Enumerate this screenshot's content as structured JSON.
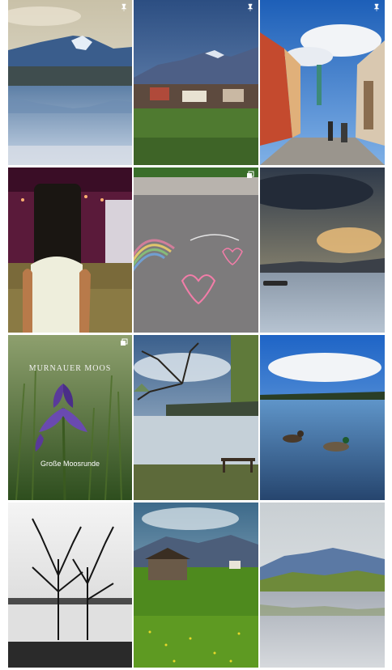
{
  "grid": {
    "posts": [
      {
        "name": "post-lake-mountain-reflection",
        "badge": "pin"
      },
      {
        "name": "post-village-mountains",
        "badge": "pin"
      },
      {
        "name": "post-old-town-street",
        "badge": "pin"
      },
      {
        "name": "post-stage-lights",
        "badge": "none"
      },
      {
        "name": "post-chalk-drawing",
        "badge": "carousel"
      },
      {
        "name": "post-sunset-lake-boat",
        "badge": "none"
      },
      {
        "name": "post-iris-flower",
        "badge": "carousel",
        "title": "MURNAUER MOOS",
        "subtitle": "Große Moosrunde"
      },
      {
        "name": "post-lake-tree-bench",
        "badge": "none"
      },
      {
        "name": "post-ducks-lake",
        "badge": "none"
      },
      {
        "name": "post-bw-trees",
        "badge": "none"
      },
      {
        "name": "post-meadow-hut",
        "badge": "none"
      },
      {
        "name": "post-lake-green-hills",
        "badge": "none"
      }
    ]
  },
  "icons": {
    "pin": "pin-icon",
    "carousel": "carousel-icon"
  }
}
